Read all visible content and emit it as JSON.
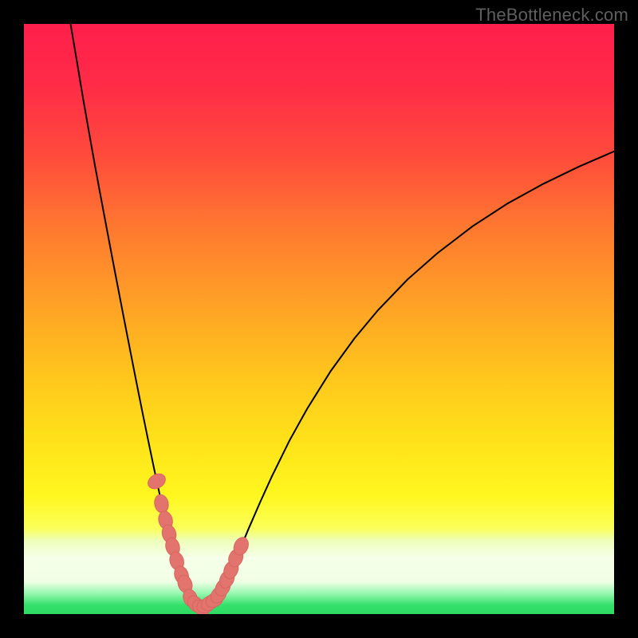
{
  "watermark": "TheBottleneck.com",
  "colors": {
    "frame": "#000000",
    "curve_stroke": "#000000",
    "marker_fill": "#e2746d",
    "marker_stroke": "#d86560",
    "green_band": "#33e06a"
  },
  "gradient_stops": [
    {
      "offset": 0.0,
      "color": "#ff1f4b"
    },
    {
      "offset": 0.1,
      "color": "#ff2b47"
    },
    {
      "offset": 0.22,
      "color": "#ff4a3c"
    },
    {
      "offset": 0.35,
      "color": "#ff7a2f"
    },
    {
      "offset": 0.48,
      "color": "#ffa325"
    },
    {
      "offset": 0.6,
      "color": "#ffc71c"
    },
    {
      "offset": 0.72,
      "color": "#ffe51a"
    },
    {
      "offset": 0.8,
      "color": "#fff71f"
    },
    {
      "offset": 0.855,
      "color": "#fbff5a"
    },
    {
      "offset": 0.875,
      "color": "#eeffb9"
    },
    {
      "offset": 0.905,
      "color": "#f6ffe8"
    },
    {
      "offset": 0.945,
      "color": "#f0ffe4"
    },
    {
      "offset": 0.965,
      "color": "#96f8b0"
    },
    {
      "offset": 0.985,
      "color": "#33e06a"
    },
    {
      "offset": 1.0,
      "color": "#2edc65"
    }
  ],
  "chart_data": {
    "type": "line",
    "title": "",
    "xlabel": "",
    "ylabel": "",
    "xlim": [
      0,
      100
    ],
    "ylim": [
      0,
      100
    ],
    "series": [
      {
        "name": "bottleneck-curve",
        "x": [
          7.9,
          9.0,
          10.0,
          11.0,
          12.0,
          13.0,
          14.0,
          15.0,
          16.0,
          17.0,
          18.0,
          19.0,
          20.0,
          21.0,
          22.0,
          23.0,
          24.0,
          25.0,
          26.0,
          27.0,
          28.0,
          28.8,
          30.0,
          31.6,
          33.0,
          34.0,
          35.0,
          36.5,
          38.0,
          40.0,
          42.0,
          45.0,
          48.0,
          52.0,
          56.0,
          60.0,
          65.0,
          70.0,
          76.0,
          82.0,
          88.0,
          94.0,
          100.0
        ],
        "y": [
          100.0,
          93.5,
          87.5,
          81.8,
          76.2,
          70.8,
          65.5,
          60.2,
          55.0,
          49.8,
          44.7,
          39.6,
          34.6,
          29.7,
          24.9,
          20.3,
          15.9,
          11.8,
          8.1,
          5.0,
          2.7,
          1.6,
          1.1,
          1.6,
          3.2,
          5.0,
          7.2,
          10.7,
          14.3,
          18.9,
          23.3,
          29.4,
          34.8,
          41.2,
          46.7,
          51.5,
          56.7,
          61.1,
          65.7,
          69.6,
          72.9,
          75.8,
          78.4
        ]
      }
    ],
    "markers": {
      "name": "highlighted-points",
      "x": [
        22.5,
        23.3,
        24.0,
        24.6,
        25.2,
        25.9,
        26.7,
        27.3,
        28.2,
        29.1,
        30.0,
        30.8,
        31.5,
        32.3,
        33.0,
        33.7,
        34.4,
        35.1,
        35.9,
        36.8
      ],
      "y": [
        22.5,
        18.7,
        15.9,
        13.6,
        11.4,
        9.0,
        6.6,
        5.1,
        2.7,
        1.7,
        1.1,
        1.4,
        1.9,
        2.4,
        3.3,
        4.5,
        5.9,
        7.5,
        9.5,
        11.5
      ]
    }
  }
}
